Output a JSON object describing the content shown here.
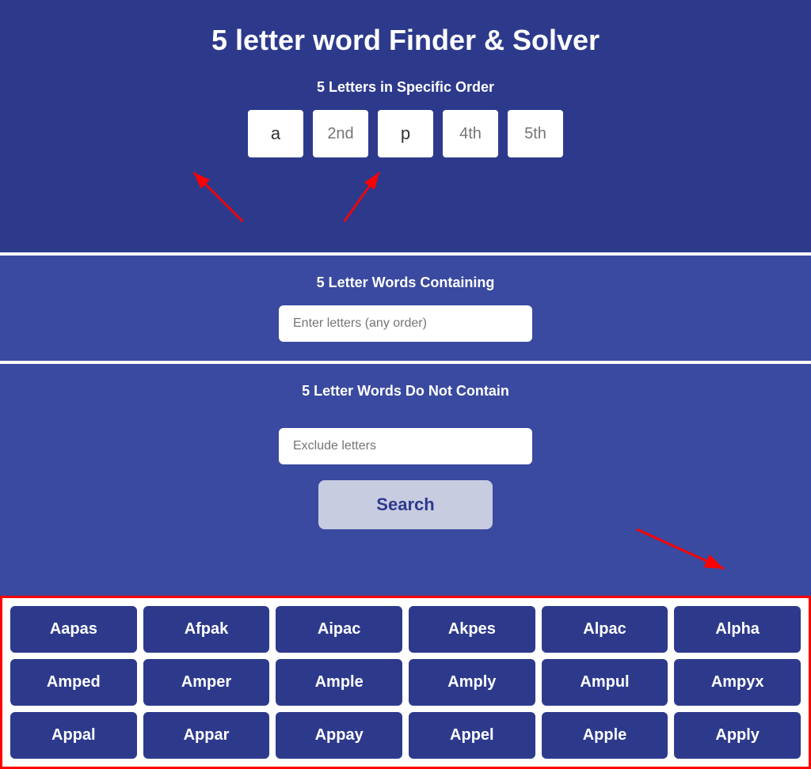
{
  "page": {
    "title": "5 letter word Finder & Solver"
  },
  "specific_order": {
    "label": "5 Letters in Specific Order",
    "boxes": [
      {
        "placeholder": "a",
        "value": "a"
      },
      {
        "placeholder": "2nd",
        "value": ""
      },
      {
        "placeholder": "p",
        "value": "p"
      },
      {
        "placeholder": "4th",
        "value": ""
      },
      {
        "placeholder": "5th",
        "value": ""
      }
    ]
  },
  "containing": {
    "label": "5 Letter Words Containing",
    "placeholder": "Enter letters (any order)"
  },
  "not_contain": {
    "label": "5 Letter Words Do Not Contain",
    "placeholder": "Exclude letters"
  },
  "search": {
    "label": "Search"
  },
  "results": {
    "words": [
      "Aapas",
      "Afpak",
      "Aipac",
      "Akpes",
      "Alpac",
      "Alpha",
      "Amped",
      "Amper",
      "Ample",
      "Amply",
      "Ampul",
      "Ampyx",
      "Appal",
      "Appar",
      "Appay",
      "Appel",
      "Apple",
      "Apply"
    ]
  }
}
